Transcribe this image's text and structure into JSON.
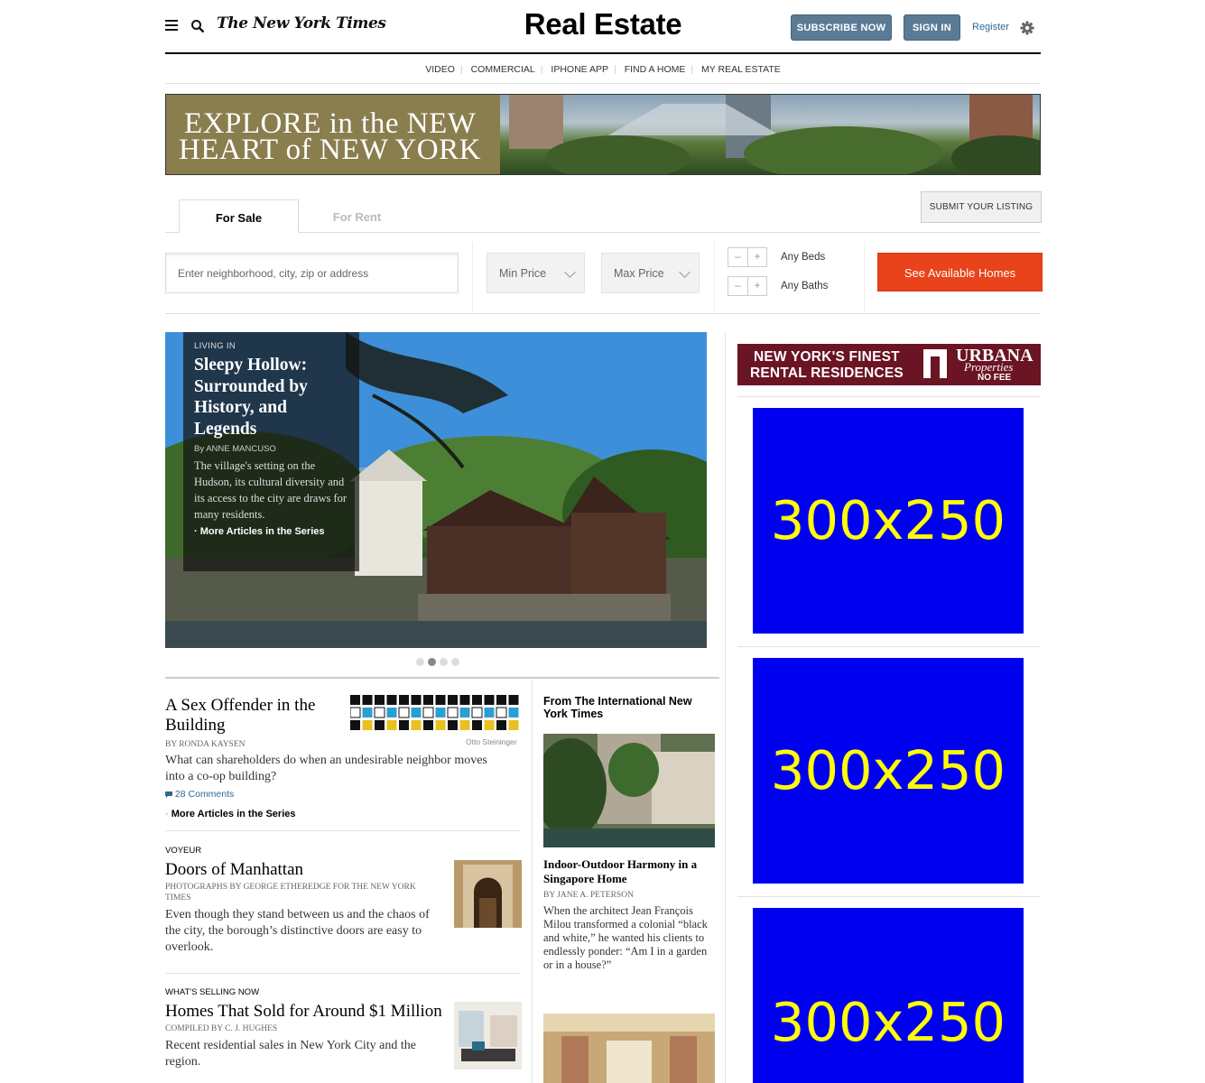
{
  "header": {
    "logo": "The New York Times",
    "section_title": "Real Estate",
    "subscribe_label": "SUBSCRIBE NOW",
    "signin_label": "SIGN IN",
    "register_label": "Register"
  },
  "subnav": {
    "items": [
      "VIDEO",
      "COMMERCIAL",
      "IPHONE APP",
      "FIND A HOME",
      "MY REAL ESTATE"
    ]
  },
  "banner": {
    "line1": "EXPLORE in the NEW",
    "line2": "HEART of NEW YORK"
  },
  "search": {
    "tab_sale": "For Sale",
    "tab_rent": "For Rent",
    "submit_listing": "SUBMIT YOUR LISTING",
    "placeholder": "Enter neighborhood, city, zip or address",
    "min_price": "Min Price",
    "max_price": "Max Price",
    "beds_label": "Any Beds",
    "baths_label": "Any Baths",
    "minus": "–",
    "plus": "+",
    "see_homes": "See Available Homes"
  },
  "hero": {
    "kicker": "LIVING IN",
    "title": "Sleepy Hollow: Surrounded by History, and Legends",
    "byline": "By ANNE MANCUSO",
    "summary": "The village's setting on the Hudson, its cultural diversity and its access to the city are draws for many residents.",
    "more": "More Articles in the Series",
    "slides": 4,
    "active_slide": 2
  },
  "stories": [
    {
      "title": "A Sex Offender in the Building",
      "byline": "By RONDA KAYSEN",
      "summary": "What can shareholders do when an undesirable neighbor moves into a co-op building?",
      "comments": "28 Comments",
      "more": "More Articles in the Series",
      "credit": "Otto Steininger"
    },
    {
      "kicker": "VOYEUR",
      "title": "Doors of Manhattan",
      "byline": "Photographs by GEORGE ETHEREDGE for THE NEW YORK TIMES",
      "summary": "Even though they stand between us and the chaos of the city, the borough’s distinctive doors are easy to overlook."
    },
    {
      "kicker": "WHAT'S SELLING NOW",
      "title": "Homes That Sold for Around $1 Million",
      "byline": "Compiled by C. J. HUGHES",
      "summary": "Recent residential sales in New York City and the region."
    }
  ],
  "international": {
    "heading": "From The International New York Times",
    "title": "Indoor-Outdoor Harmony in a Singapore Home",
    "byline": "By JANE A. PETERSON",
    "summary": "When the architect Jean François Milou transformed a colonial “black and white,” he wanted his clients to endlessly ponder: “Am I in a garden or in a house?”"
  },
  "ads": {
    "urbana_line1": "NEW YORK'S FINEST",
    "urbana_line2": "RENTAL RESIDENCES",
    "urbana_brand": "URBANA",
    "urbana_sub": "Properties",
    "urbana_nofee": "NO FEE",
    "placeholder": "300x250"
  },
  "colors": {
    "accent_button": "#e8431b",
    "header_button": "#5b7b95",
    "ad_bg": "#0000f0",
    "ad_text": "#ffff00"
  }
}
